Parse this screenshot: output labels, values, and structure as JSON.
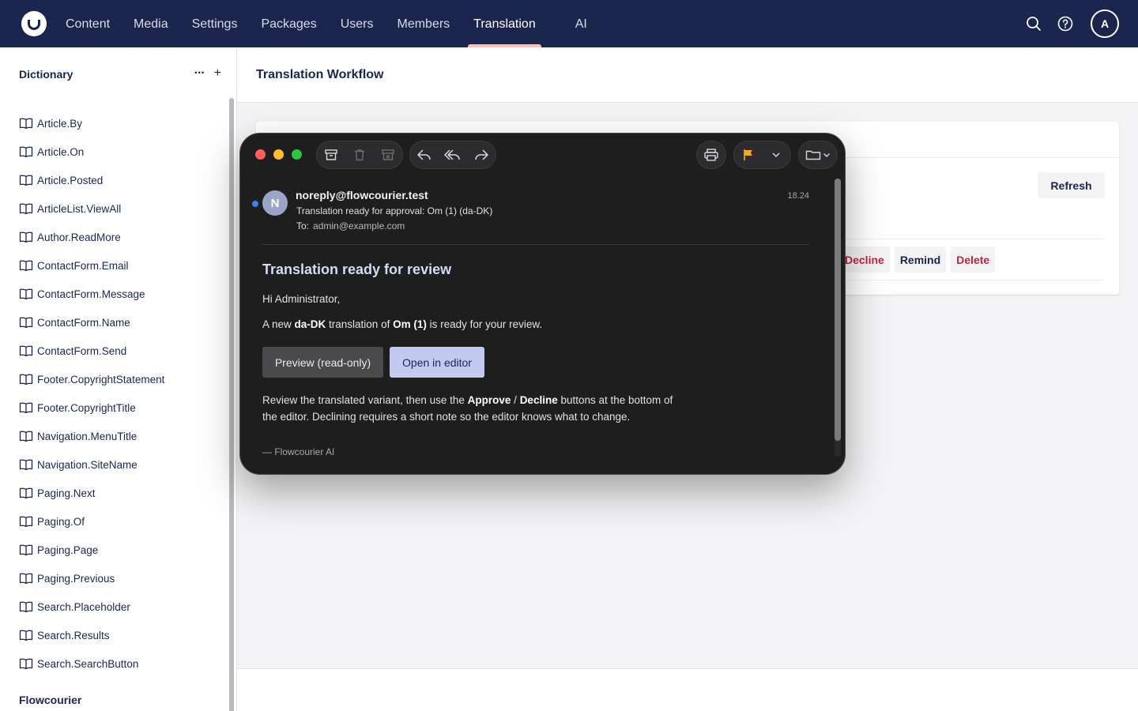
{
  "header": {
    "nav": [
      "Content",
      "Media",
      "Settings",
      "Packages",
      "Users",
      "Members",
      "Translation",
      "AI"
    ],
    "active_nav": "Translation",
    "avatar_initial": "A"
  },
  "sidebar": {
    "title": "Dictionary",
    "more_label": "···",
    "add_label": "+",
    "items": [
      "Article.By",
      "Article.On",
      "Article.Posted",
      "ArticleList.ViewAll",
      "Author.ReadMore",
      "ContactForm.Email",
      "ContactForm.Message",
      "ContactForm.Name",
      "ContactForm.Send",
      "Footer.CopyrightStatement",
      "Footer.CopyrightTitle",
      "Navigation.MenuTitle",
      "Navigation.SiteName",
      "Paging.Next",
      "Paging.Of",
      "Paging.Page",
      "Paging.Previous",
      "Search.Placeholder",
      "Search.Results",
      "Search.SearchButton"
    ],
    "footer_title": "Flowcourier"
  },
  "main": {
    "title": "Translation Workflow",
    "refresh_label": "Refresh",
    "actions": {
      "decline": "Decline",
      "remind": "Remind",
      "delete": "Delete"
    }
  },
  "mail": {
    "avatar_initial": "N",
    "from": "noreply@flowcourier.test",
    "subject": "Translation ready for approval: Om (1) (da-DK)",
    "to_label": "To:",
    "to": "admin@example.com",
    "time": "18.24",
    "heading": "Translation ready for review",
    "greeting": "Hi Administrator,",
    "line1_pre": "A new ",
    "line1_lang": "da-DK",
    "line1_mid": " translation of ",
    "line1_doc": "Om (1)",
    "line1_post": " is ready for your review.",
    "preview_label": "Preview (read-only)",
    "open_label": "Open in editor",
    "review_pre": "Review the translated variant, then use the ",
    "review_approve": "Approve",
    "review_slash": " / ",
    "review_decline": "Decline",
    "review_post1": " buttons at the bottom of",
    "review_line2": "the editor. Declining requires a short note so the editor knows what to change.",
    "signature": "— Flowcourier AI"
  },
  "colors": {
    "header_bg": "#1b264f",
    "active_underline": "#f5c1bc",
    "danger": "#c4243b",
    "mail_bg": "#1e1e1f",
    "open_btn": "#c2cbef"
  }
}
